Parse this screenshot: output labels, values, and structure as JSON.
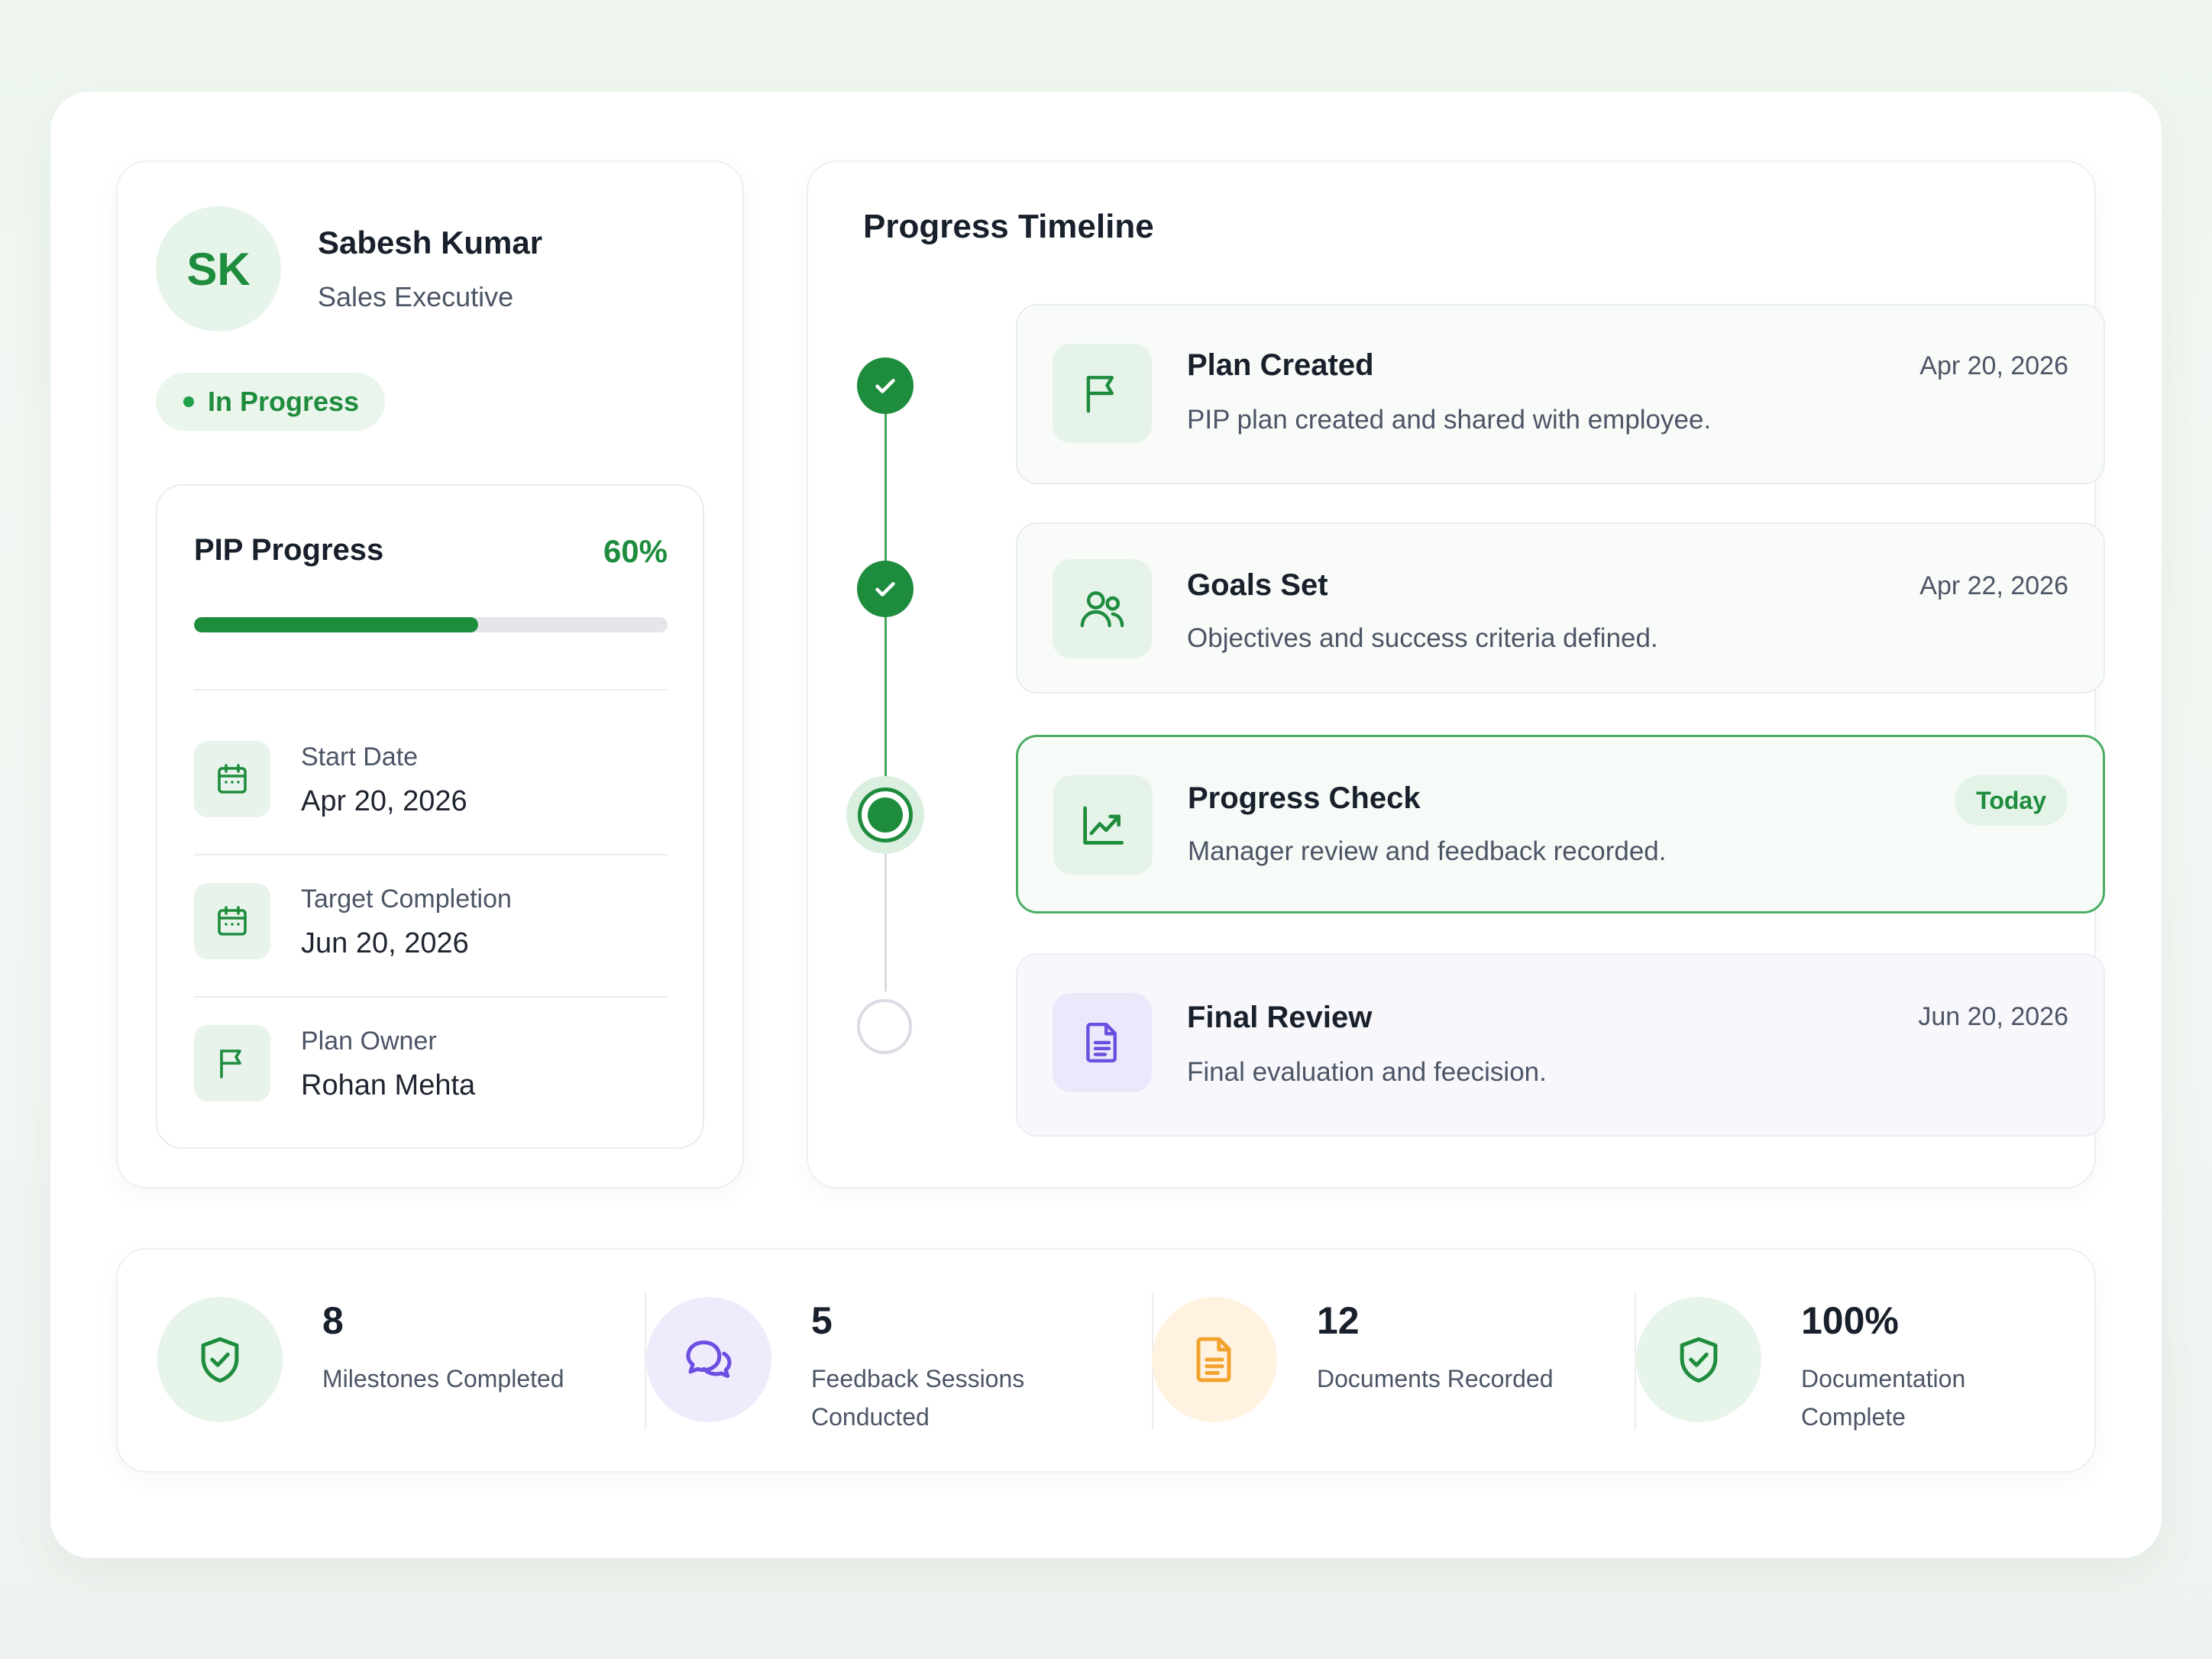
{
  "profile": {
    "initials": "SK",
    "name": "Sabesh Kumar",
    "role": "Sales Executive",
    "status": "In Progress"
  },
  "pip": {
    "title": "PIP Progress",
    "percent_label": "60%",
    "progress": 0.6,
    "start_label": "Start Date",
    "start_value": "Apr 20, 2026",
    "target_label": "Target Completion",
    "target_value": "Jun 20, 2026",
    "owner_label": "Plan Owner",
    "owner_value": "Rohan Mehta"
  },
  "timeline": {
    "title": "Progress Timeline",
    "events": [
      {
        "title": "Plan Created",
        "desc": "PIP plan created and shared with employee.",
        "date": "Apr 20, 2026",
        "state": "done",
        "icon": "flag-icon"
      },
      {
        "title": "Goals Set",
        "desc": "Objectives and success criteria defined.",
        "date": "Apr 22, 2026",
        "state": "done",
        "icon": "users-icon"
      },
      {
        "title": "Progress Check",
        "desc": "Manager review and feedback recorded.",
        "date": "Today",
        "state": "current",
        "icon": "trend-chart-icon"
      },
      {
        "title": "Final Review",
        "desc": "Final evaluation and feecision.",
        "date": "Jun 20, 2026",
        "state": "pending",
        "icon": "document-icon"
      }
    ]
  },
  "stats": [
    {
      "value": "8",
      "label": "Milestones Completed",
      "icon": "shield-check-icon"
    },
    {
      "value": "5",
      "label": "Feedback Sessions Conducted",
      "icon": "chat-bubbles-icon"
    },
    {
      "value": "12",
      "label": "Documents Recorded",
      "icon": "document-icon"
    },
    {
      "value": "100%",
      "label": "Documentation Complete",
      "icon": "shield-check-icon"
    }
  ],
  "colors": {
    "accent": "#1e8c3d",
    "accent_soft": "#e6f4ea",
    "purple": "#6b4fe0",
    "purple_soft": "#efebfd",
    "orange": "#f2a32e",
    "orange_soft": "#fff2e1"
  }
}
